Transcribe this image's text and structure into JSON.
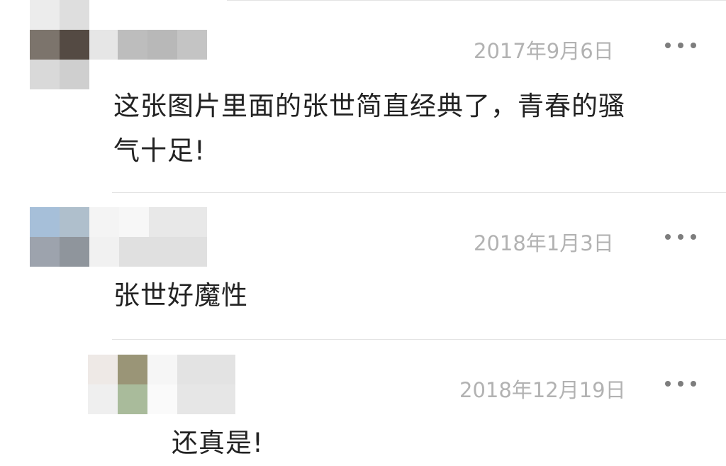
{
  "comments": [
    {
      "date": "2017年9月6日",
      "text_line1": "这张图片里面的张世简直经典了，青春的骚",
      "text_line2": "气十足!",
      "more_icon": "more-horizontal-icon"
    },
    {
      "date": "2018年1月3日",
      "text": "张世好魔性",
      "more_icon": "more-horizontal-icon"
    },
    {
      "date": "2018年12月19日",
      "text": "还真是!",
      "more_icon": "more-horizontal-icon",
      "is_reply": true
    }
  ],
  "colors": {
    "date": "#b2b2b2",
    "comment_text": "#222222",
    "more_dots": "#7d7d7d",
    "divider": "#e3e3e3"
  }
}
